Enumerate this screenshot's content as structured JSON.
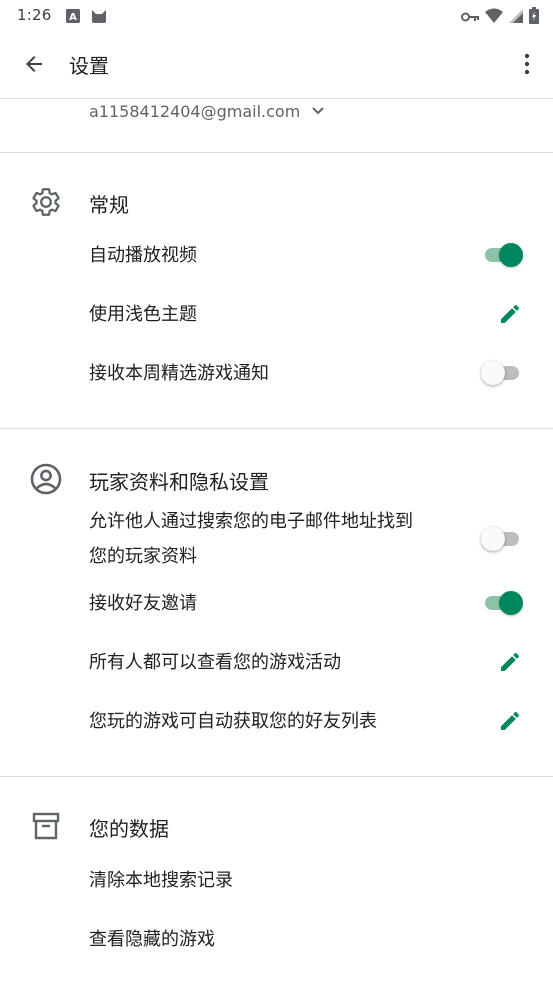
{
  "status_bar": {
    "time": "1:26",
    "left_icons": [
      "a-icon",
      "cat-icon"
    ],
    "right_icons": [
      "key-icon",
      "wifi-icon",
      "signal-icon",
      "battery-icon"
    ]
  },
  "app_bar": {
    "title": "设置",
    "back_icon": "arrow-back-icon",
    "menu_icon": "more-vert-icon"
  },
  "account": {
    "email": "a1158412404@gmail.com"
  },
  "sections": {
    "general": {
      "title": "常规",
      "icon": "gear-icon",
      "items": [
        {
          "label": "自动播放视频",
          "control": "toggle",
          "on": true
        },
        {
          "label": "使用浅色主题",
          "control": "edit"
        },
        {
          "label": "接收本周精选游戏通知",
          "control": "toggle",
          "on": false
        }
      ]
    },
    "profile": {
      "title": "玩家资料和隐私设置",
      "icon": "account-circle-icon",
      "items": [
        {
          "label_line1": "允许他人通过搜索您的电子邮件地址找到",
          "label_line2": "您的玩家资料",
          "control": "toggle",
          "on": false
        },
        {
          "label": "接收好友邀请",
          "control": "toggle",
          "on": true
        },
        {
          "label": "所有人都可以查看您的游戏活动",
          "control": "edit"
        },
        {
          "label": "您玩的游戏可自动获取您的好友列表",
          "control": "edit"
        }
      ]
    },
    "data": {
      "title": "您的数据",
      "icon": "archive-icon",
      "items": [
        {
          "label": "清除本地搜索记录"
        },
        {
          "label": "查看隐藏的游戏"
        }
      ]
    }
  },
  "colors": {
    "accent": "#01875f",
    "accent_track": "#8cc2a8",
    "divider": "#dadce0",
    "text_primary": "#202124",
    "text_secondary": "#5f6368"
  }
}
